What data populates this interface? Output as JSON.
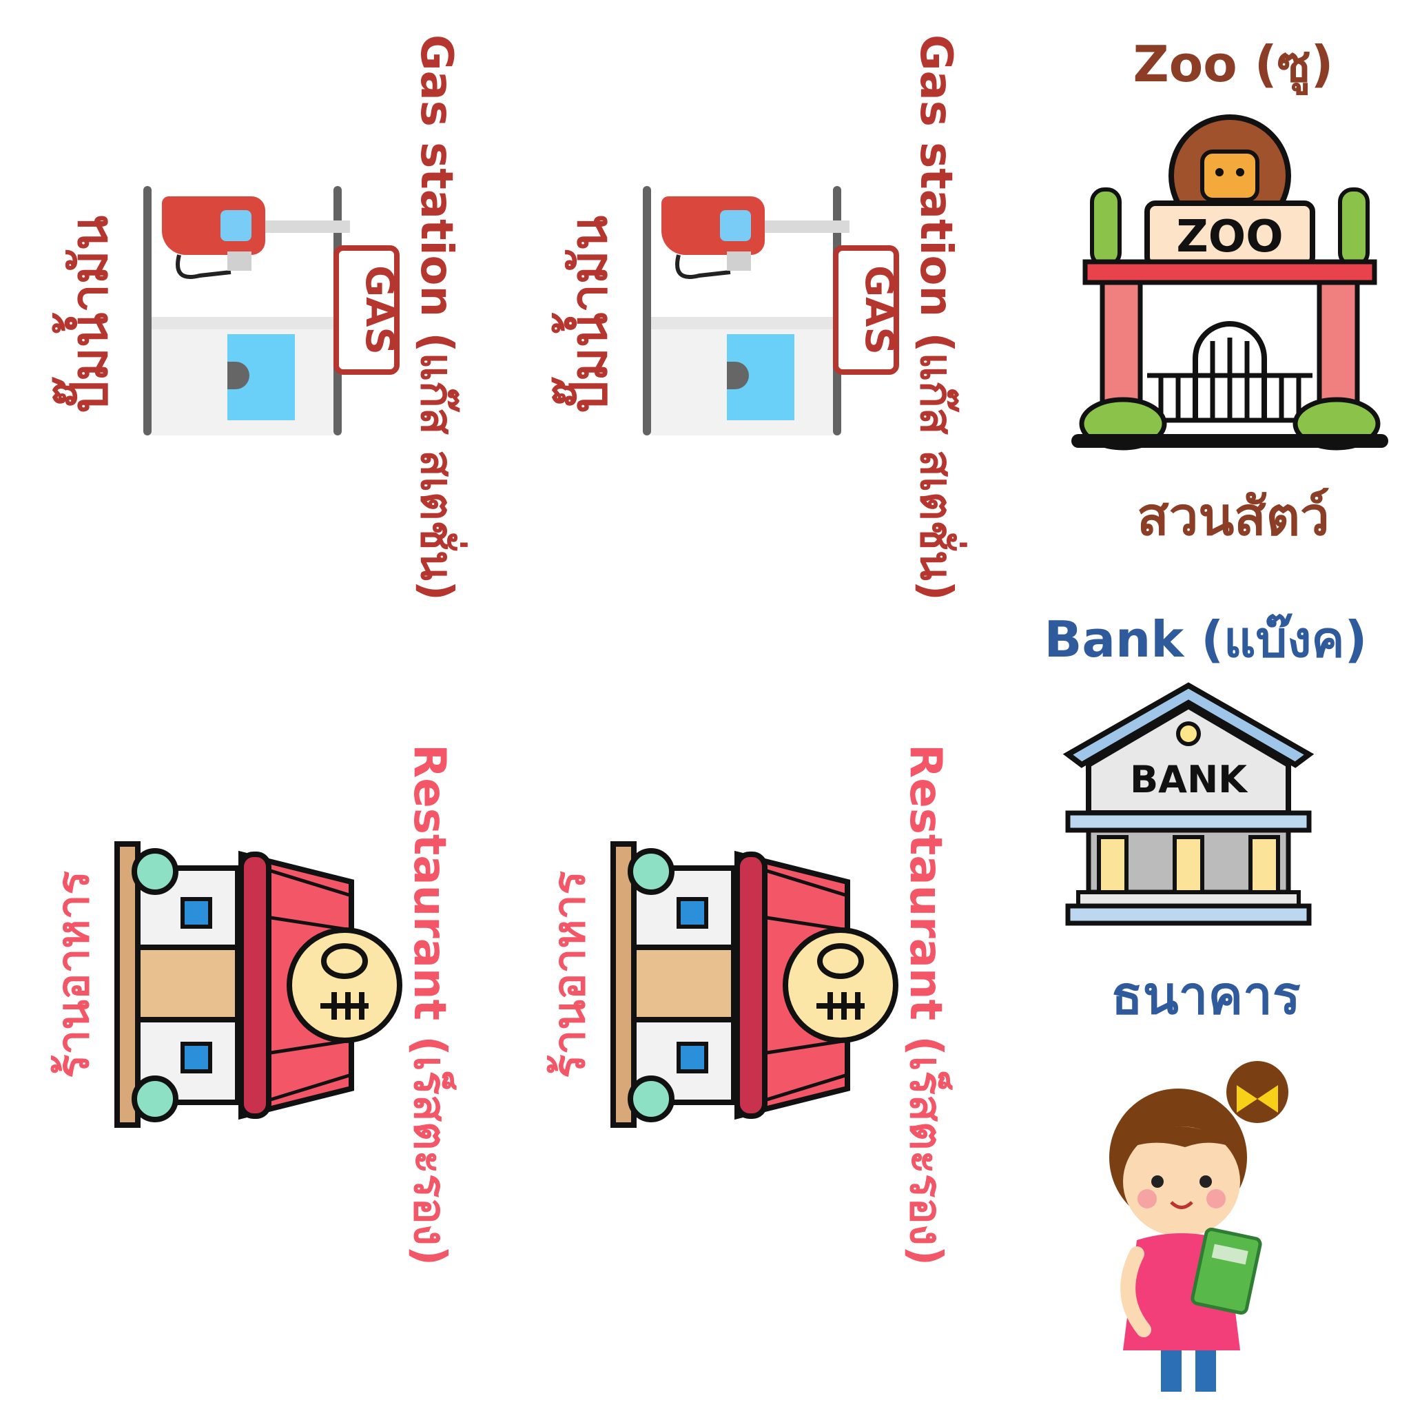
{
  "gas_cards": [
    {
      "title": "Gas station (แก๊ส สเตชั่น)",
      "thai": "ปั๊มน้ำมัน",
      "sign": "GAS"
    },
    {
      "title": "Gas station (แก๊ส สเตชั่น)",
      "thai": "ปั๊มน้ำมัน",
      "sign": "GAS"
    }
  ],
  "restaurant_cards": [
    {
      "title": "Restaurant (เร็สตะรอง)",
      "thai": "ร้านอาหาร"
    },
    {
      "title": "Restaurant (เร็สตะรอง)",
      "thai": "ร้านอาหาร"
    }
  ],
  "zoo_card": {
    "title": "Zoo (ซู)",
    "thai": "สวนสัตว์",
    "sign": "ZOO"
  },
  "bank_card": {
    "title": "Bank (แบ๊งค)",
    "thai": "ธนาคาร",
    "sign": "BANK"
  },
  "colors": {
    "gas_text": "#b5352f",
    "restaurant_text": "#f25667",
    "zoo_text": "#8b3d26",
    "bank_text": "#2f5a9c"
  },
  "icons": [
    "gas-station-icon",
    "restaurant-icon",
    "zoo-gate-icon",
    "bank-building-icon",
    "girl-with-book-illustration"
  ]
}
